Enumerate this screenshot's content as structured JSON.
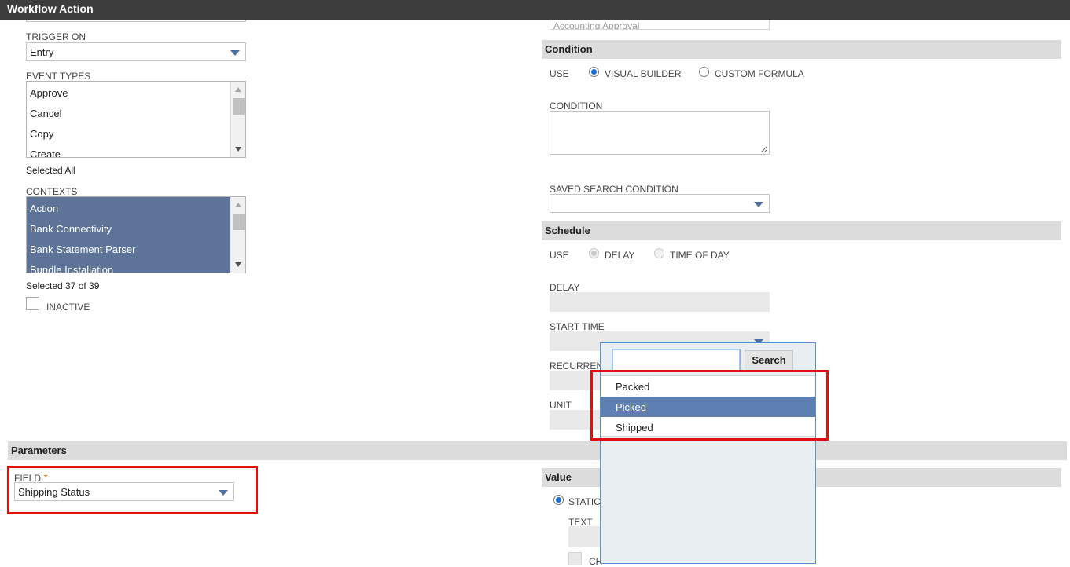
{
  "window": {
    "title": "Workflow Action"
  },
  "left": {
    "trigger_on": {
      "label": "TRIGGER ON",
      "value": "Entry"
    },
    "event_types": {
      "label": "EVENT TYPES",
      "items": [
        "Approve",
        "Cancel",
        "Copy",
        "Create"
      ],
      "footer": "Selected All"
    },
    "contexts": {
      "label": "CONTEXTS",
      "items": [
        "Action",
        "Bank Connectivity",
        "Bank Statement Parser",
        "Bundle Installation"
      ],
      "footer": "Selected 37 of 39"
    },
    "inactive": {
      "label": "INACTIVE",
      "checked": false
    }
  },
  "right": {
    "top_select": {
      "value": "Accounting Approval"
    },
    "condition": {
      "header": "Condition",
      "use_label": "USE",
      "option_visual": "VISUAL BUILDER",
      "option_custom": "CUSTOM FORMULA",
      "selected": "VISUAL BUILDER",
      "condition_label": "CONDITION",
      "saved_search_label": "SAVED SEARCH CONDITION"
    },
    "schedule": {
      "header": "Schedule",
      "use_label": "USE",
      "option_delay": "DELAY",
      "option_time": "TIME OF DAY",
      "delay_label": "DELAY",
      "start_time_label": "START TIME",
      "recurrence_label": "RECURRENC",
      "unit_label": "UNIT"
    }
  },
  "parameters": {
    "header": "Parameters",
    "field_label": "FIELD",
    "required_mark": "*",
    "field_value": "Shipping Status"
  },
  "value_section": {
    "header": "Value",
    "static_label": "STATIC",
    "text_label": "TEXT",
    "checkbox_label": "CH"
  },
  "popup": {
    "search_button": "Search",
    "search_value": "",
    "options": [
      "Packed",
      "Picked",
      "Shipped"
    ],
    "highlighted": "Picked"
  },
  "colors": {
    "title_bar": "#3d3d3d",
    "selected_list": "#5d7498",
    "highlight_option": "#5d7fb1",
    "annotation_red": "#e01010"
  }
}
